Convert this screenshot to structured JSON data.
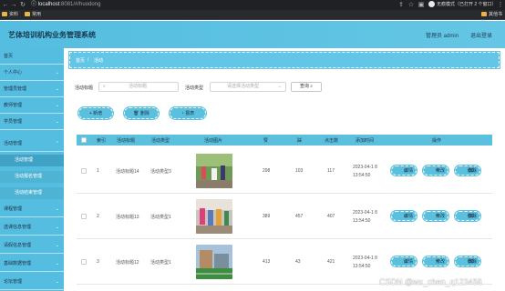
{
  "browser": {
    "url_host": "localhost",
    "url_path": ":8081/#/huodong",
    "bookmarks": [
      "资料",
      "常用"
    ],
    "bookmark_right": "其他书签",
    "incognito_label": "无痕模式（已打开 2 个窗口）"
  },
  "header": {
    "title": "艺体培训机构业务管理系统",
    "user": "管理员 admin",
    "logout": "退出登录"
  },
  "sidebar": {
    "items": [
      {
        "label": "首页",
        "chev": ""
      },
      {
        "label": "个人中心",
        "chev": "⌄"
      },
      {
        "label": "管理员管理",
        "chev": "⌄"
      },
      {
        "label": "教师管理",
        "chev": "⌄"
      },
      {
        "label": "学员管理",
        "chev": "⌄"
      },
      {
        "label": "活动管理",
        "chev": "⌃"
      }
    ],
    "subitems": [
      "活动管理",
      "活动报名管理",
      "活动结束管理"
    ],
    "items_after": [
      {
        "label": "课程管理",
        "chev": "⌄"
      },
      {
        "label": "选课信息管理",
        "chev": "⌄"
      },
      {
        "label": "请假信息管理",
        "chev": "⌄"
      },
      {
        "label": "基础数据管理",
        "chev": "⌄"
      },
      {
        "label": "论坛管理",
        "chev": "⌄"
      }
    ]
  },
  "breadcrumb": {
    "home": "首页",
    "current": "活动"
  },
  "search": {
    "title_label": "活动标题",
    "title_placeholder": "活动标题",
    "type_label": "活动类型",
    "type_placeholder": "请选择活动类型",
    "search_button": "查询"
  },
  "actions": {
    "add": "新增",
    "delete": "删除",
    "report": "报表"
  },
  "table": {
    "headers": [
      "索引",
      "活动标题",
      "活动类型",
      "活动图片",
      "赞",
      "踩",
      "点击数",
      "添加时间",
      "操作"
    ],
    "rows": [
      {
        "index": "1",
        "title": "活动标题14",
        "type": "活动类型3",
        "likes": "298",
        "dislikes": "103",
        "clicks": "117",
        "time": "2023-04-1 8 13:54:50"
      },
      {
        "index": "2",
        "title": "活动标题13",
        "type": "活动类型1",
        "likes": "389",
        "dislikes": "457",
        "clicks": "407",
        "time": "2023-04-1 8 13:54:50"
      },
      {
        "index": "3",
        "title": "活动标题12",
        "type": "活动类型1",
        "likes": "413",
        "dislikes": "43",
        "clicks": "421",
        "time": "2023-04-1 8 13:54:50"
      }
    ],
    "row_buttons": {
      "detail": "详情",
      "edit": "修改",
      "delete": "删除"
    }
  },
  "watermark": "CSDN @wx_chen_q123456",
  "colors": {
    "accent": "#5bc0de",
    "header_text": "#173a52"
  }
}
